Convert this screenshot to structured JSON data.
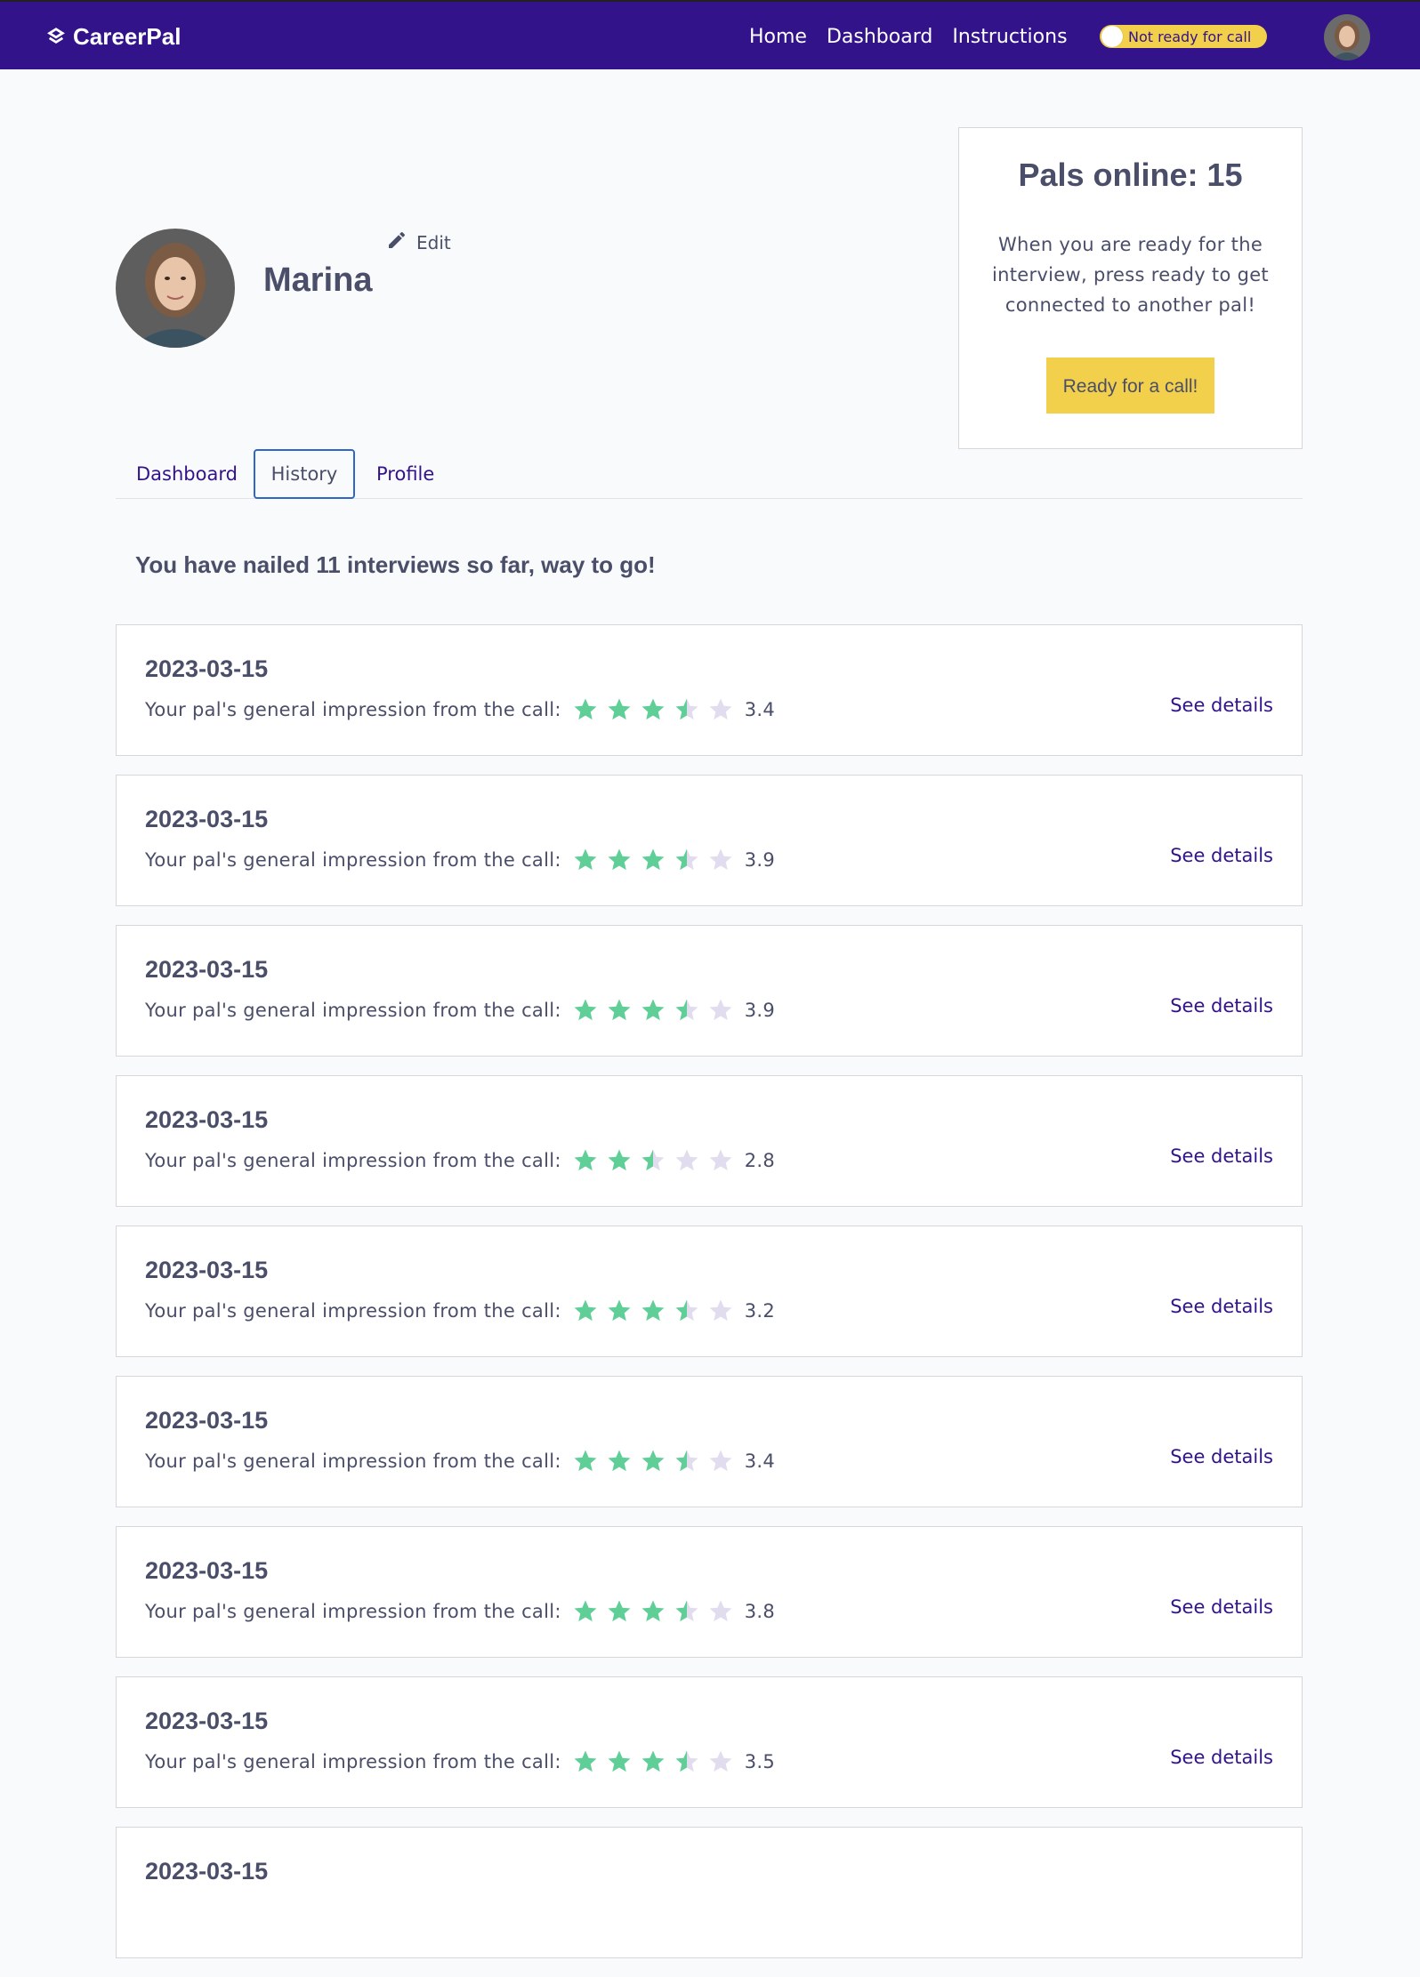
{
  "brand": {
    "name": "CareerPal"
  },
  "nav": {
    "home": "Home",
    "dashboard": "Dashboard",
    "instructions": "Instructions"
  },
  "status_toggle": {
    "label": "Not ready for call",
    "on": false
  },
  "profile": {
    "name": "Marina",
    "edit_label": "Edit"
  },
  "online_card": {
    "title": "Pals online: 15",
    "description": "When you are ready for the interview, press ready to get connected to another pal!",
    "button": "Ready for a call!"
  },
  "tabs": [
    {
      "label": "Dashboard",
      "active": false
    },
    {
      "label": "History",
      "active": true
    },
    {
      "label": "Profile",
      "active": false
    }
  ],
  "summary": "You have nailed 11 interviews so far, way to go!",
  "history": [
    {
      "date": "2023-03-15",
      "impression_label": "Your pal's general impression from the call:",
      "rating": 3.4,
      "rating_text": "3.4",
      "details": "See details"
    },
    {
      "date": "2023-03-15",
      "impression_label": "Your pal's general impression from the call:",
      "rating": 3.9,
      "rating_text": "3.9",
      "details": "See details"
    },
    {
      "date": "2023-03-15",
      "impression_label": "Your pal's general impression from the call:",
      "rating": 3.9,
      "rating_text": "3.9",
      "details": "See details"
    },
    {
      "date": "2023-03-15",
      "impression_label": "Your pal's general impression from the call:",
      "rating": 2.8,
      "rating_text": "2.8",
      "details": "See details"
    },
    {
      "date": "2023-03-15",
      "impression_label": "Your pal's general impression from the call:",
      "rating": 3.2,
      "rating_text": "3.2",
      "details": "See details"
    },
    {
      "date": "2023-03-15",
      "impression_label": "Your pal's general impression from the call:",
      "rating": 3.4,
      "rating_text": "3.4",
      "details": "See details"
    },
    {
      "date": "2023-03-15",
      "impression_label": "Your pal's general impression from the call:",
      "rating": 3.8,
      "rating_text": "3.8",
      "details": "See details"
    },
    {
      "date": "2023-03-15",
      "impression_label": "Your pal's general impression from the call:",
      "rating": 3.5,
      "rating_text": "3.5",
      "details": "See details"
    },
    {
      "date": "2023-03-15",
      "impression_label": "",
      "rating": 0,
      "rating_text": "",
      "details": ""
    }
  ],
  "colors": {
    "brand": "#33138a",
    "accent_yellow": "#f2d04b",
    "star_filled": "#5fcf97",
    "star_empty": "#e2dcef",
    "text": "#4a4e69"
  },
  "icons": {
    "logo": "careerpal-logo-icon",
    "edit": "pencil-icon",
    "star": "star-icon"
  }
}
